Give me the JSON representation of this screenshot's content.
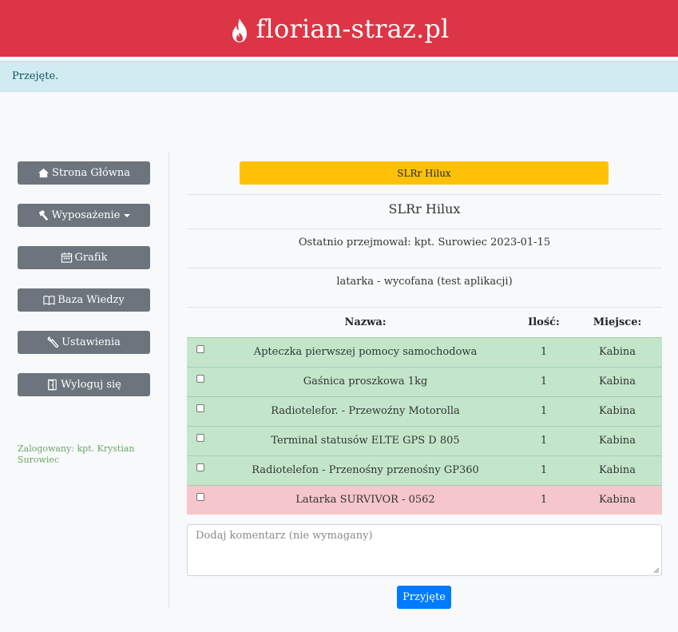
{
  "header": {
    "brand": "florian-straz.pl",
    "brand_color": "#dc3545",
    "logo_icon": "flame-icon"
  },
  "alert": {
    "text": "Przejęte.",
    "color": "#d1ecf1"
  },
  "sidebar": {
    "items": [
      {
        "label": "Strona Główna",
        "icon": "home-icon"
      },
      {
        "label": "Wyposażenie",
        "icon": "hammer-icon",
        "dropdown": true
      },
      {
        "label": "Grafik",
        "icon": "calendar-icon"
      },
      {
        "label": "Baza Wiedzy",
        "icon": "book-icon"
      },
      {
        "label": "Ustawienia",
        "icon": "wrench-icon"
      },
      {
        "label": "Wyloguj się",
        "icon": "door-icon"
      }
    ],
    "logged_in": "Zalogowany: kpt. Krystian Surowiec"
  },
  "main": {
    "vehicle_button": "SLRr Hilux",
    "title": "SLRr Hilux",
    "last_taken": "Ostatnio przejmował: kpt. Surowiec 2023-01-15",
    "note": "latarka - wycofana (test aplikacji)",
    "table": {
      "headers": [
        "Nazwa:",
        "Ilość:",
        "Miejsce:"
      ],
      "rows": [
        {
          "name": "Apteczka pierwszej pomocy samochodowa",
          "qty": "1",
          "place": "Kabina",
          "status": "ok"
        },
        {
          "name": "Gaśnica proszkowa 1kg",
          "qty": "1",
          "place": "Kabina",
          "status": "ok"
        },
        {
          "name": "Radiotelefor. - Przewoźny Motorolla",
          "qty": "1",
          "place": "Kabina",
          "status": "ok"
        },
        {
          "name": "Terminal statusów ELTE GPS D 805",
          "qty": "1",
          "place": "Kabina",
          "status": "ok"
        },
        {
          "name": "Radiotelefon - Przenośny przenośny GP360",
          "qty": "1",
          "place": "Kabina",
          "status": "ok"
        },
        {
          "name": "Latarka SURVIVOR - 0562",
          "qty": "1",
          "place": "Kabina",
          "status": "bad"
        }
      ]
    },
    "comment_placeholder": "Dodaj komentarz (nie wymagany)",
    "submit_label": "Przyjęte"
  }
}
